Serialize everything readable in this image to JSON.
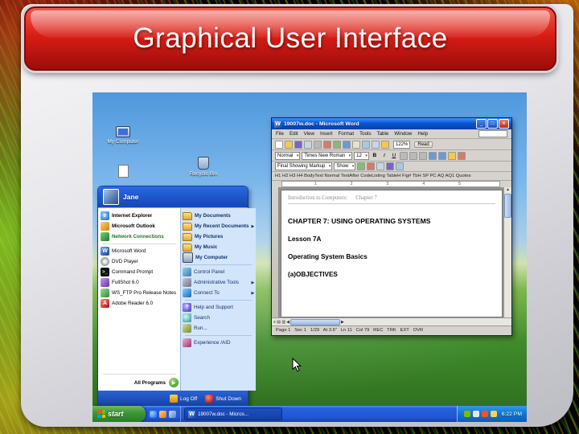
{
  "slide": {
    "title": "Graphical User Interface"
  },
  "desktop": {
    "icons": [
      {
        "label": "My Computer"
      },
      {
        "label": "Recycle Bin"
      }
    ]
  },
  "start_menu": {
    "user_name": "Jane",
    "pinned": [
      {
        "label": "Internet Explorer"
      },
      {
        "label": "Microsoft Outlook"
      },
      {
        "label": "Network Connections"
      }
    ],
    "recent": [
      {
        "label": "Microsoft Word"
      },
      {
        "label": "DVD Player"
      },
      {
        "label": "Command Prompt"
      },
      {
        "label": "FullShot 6.0"
      },
      {
        "label": "WS_FTP Pro Release Notes"
      },
      {
        "label": "Adobe Reader 6.0"
      }
    ],
    "all_programs_label": "All Programs",
    "right": [
      {
        "label": "My Documents"
      },
      {
        "label": "My Recent Documents"
      },
      {
        "label": "My Pictures"
      },
      {
        "label": "My Music"
      },
      {
        "label": "My Computer"
      },
      {
        "label": "Control Panel"
      },
      {
        "label": "Administrative Tools"
      },
      {
        "label": "Connect To"
      },
      {
        "label": "Help and Support"
      },
      {
        "label": "Search"
      },
      {
        "label": "Run..."
      },
      {
        "label": "Experience /AID"
      }
    ],
    "log_off_label": "Log Off",
    "shut_down_label": "Shut Down"
  },
  "word": {
    "window_title": "19007w.doc - Microsoft Word",
    "menu_items": [
      "File",
      "Edit",
      "View",
      "Insert",
      "Format",
      "Tools",
      "Table",
      "Window",
      "Help"
    ],
    "zoom_value": "122%",
    "read_label": "Read",
    "paragraph_style": "Normal",
    "font_name": "Times New Roman",
    "font_size": "12",
    "markup_mode": "Final Showing Markup",
    "show_label": "Show",
    "style_shortcuts": [
      "H1",
      "H2",
      "H3",
      "H4",
      "BodyText",
      "Normal",
      "TextAfter",
      "CodeListing",
      "TableH",
      "Fig#",
      "TbH",
      "SP",
      "PC",
      "AQ",
      "AQ1",
      "Quotes"
    ],
    "ruler_numbers": [
      "1",
      "2",
      "3",
      "4",
      "5"
    ],
    "document": {
      "header": "Introduction to Computers:      Chapter 7",
      "lines": [
        "CHAPTER 7: USING OPERATING SYSTEMS",
        "Lesson 7A",
        "Operating System Basics",
        "(a)OBJECTIVES"
      ]
    },
    "status_items": [
      "Page 1",
      "Sec 1",
      "1/29",
      "At 3.6\"",
      "Ln 11",
      "Col 79",
      "REC",
      "TRK",
      "EXT",
      "OVR"
    ]
  },
  "taskbar": {
    "start_label": "start",
    "task_button": "19007w.doc - Micros...",
    "tray_time": "6:22 PM"
  }
}
